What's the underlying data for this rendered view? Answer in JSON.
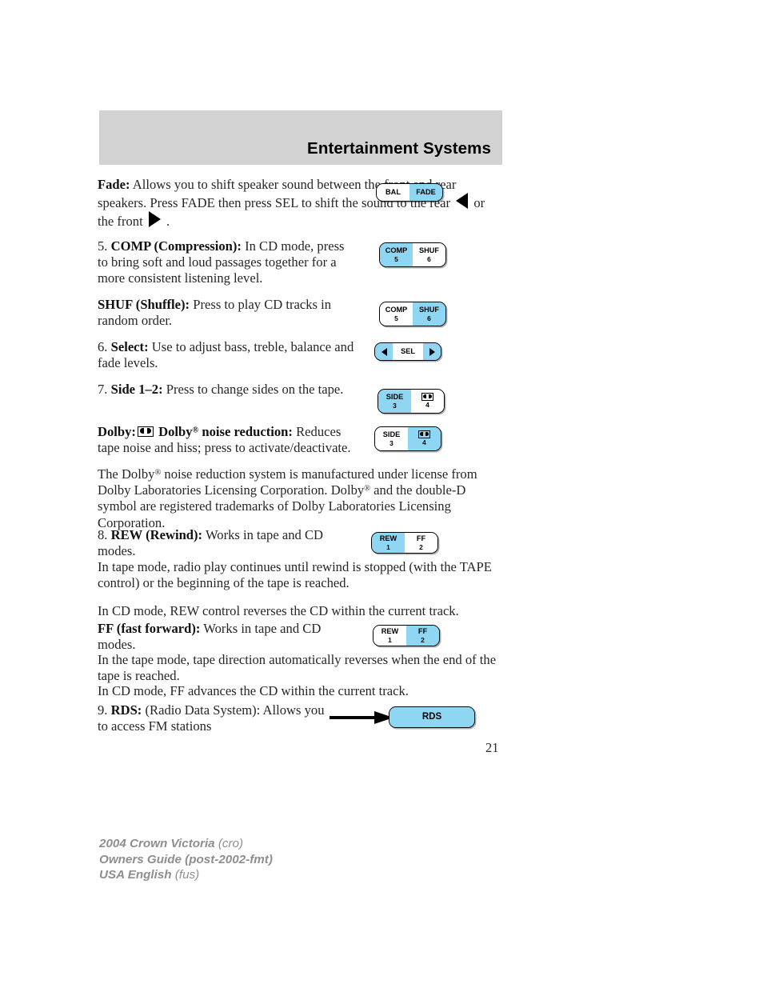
{
  "header": {
    "title": "Entertainment Systems"
  },
  "sections": {
    "fade": {
      "term": "Fade:",
      "text_before_rear_arrow": " Allows you to shift speaker sound between the front and rear speakers. Press FADE then press SEL to shift the sound to the rear ",
      "text_between_arrows": " or the front ",
      "text_after_front_arrow": " ."
    },
    "comp": {
      "number": "5.",
      "term": "COMP (Compression):",
      "text": " In CD mode, press to bring soft and loud passages together for a more consistent listening level."
    },
    "shuf": {
      "term": "SHUF (Shuffle):",
      "text": " Press to play CD tracks in random order."
    },
    "select": {
      "number": "6.",
      "term": "Select:",
      "text": " Use to adjust bass, treble, balance and fade levels."
    },
    "side": {
      "number": "7.",
      "term": "Side 1–2:",
      "text": " Press to change sides on the tape."
    },
    "dolby": {
      "term_a": "Dolby:",
      "term_b": "Dolby",
      "term_b_sup": "®",
      "term_c": "noise reduction:",
      "text": " Reduces tape noise and hiss; press to activate/deactivate.",
      "legal_part1": "The Dolby",
      "legal_sup1": "®",
      "legal_part2": " noise reduction system is manufactured under license from Dolby Laboratories Licensing Corporation. Dolby",
      "legal_sup2": "®",
      "legal_part3": " and the double-D symbol are registered trademarks of Dolby Laboratories Licensing Corporation."
    },
    "rew": {
      "number": "8.",
      "term": "REW (Rewind):",
      "text": " Works in tape and CD modes.",
      "para2": "In tape mode, radio play continues until rewind is stopped (with the TAPE control) or the beginning of the tape is reached.",
      "para3": "In CD mode, REW control reverses the CD within the current track."
    },
    "ff": {
      "term": "FF (fast forward):",
      "text": " Works in tape and CD modes.",
      "para2": "In the tape mode, tape direction automatically reverses when the end of the tape is reached.",
      "para3": "In CD mode, FF advances the CD within the current track."
    },
    "rds": {
      "number": "9.",
      "term": "RDS:",
      "text": " (Radio Data System): Allows you to access FM stations"
    }
  },
  "button_graphics": {
    "bal_fade": {
      "left_label": "BAL",
      "left_sub": "",
      "right_label": "FADE",
      "right_sub": "",
      "highlight": "right"
    },
    "comp_shuf_comp_on": {
      "left_label": "COMP",
      "left_sub": "5",
      "right_label": "SHUF",
      "right_sub": "6",
      "highlight": "left"
    },
    "comp_shuf_shuf_on": {
      "left_label": "COMP",
      "left_sub": "5",
      "right_label": "SHUF",
      "right_sub": "6",
      "highlight": "right"
    },
    "sel": {
      "label": "SEL",
      "left_icon": "triangle-left-icon",
      "right_icon": "triangle-right-icon",
      "highlight": "both-sides"
    },
    "side_side_on": {
      "left_label": "SIDE",
      "left_sub": "3",
      "right_label": "dolby-double-d-icon",
      "right_sub": "4",
      "highlight": "left"
    },
    "side_dolby_on": {
      "left_label": "SIDE",
      "left_sub": "3",
      "right_label": "dolby-double-d-icon",
      "right_sub": "4",
      "highlight": "right"
    },
    "rew_ff_rew_on": {
      "left_label": "REW",
      "left_sub": "1",
      "right_label": "FF",
      "right_sub": "2",
      "highlight": "left"
    },
    "rew_ff_ff_on": {
      "left_label": "REW",
      "left_sub": "1",
      "right_label": "FF",
      "right_sub": "2",
      "highlight": "right"
    },
    "rds": {
      "label": "RDS",
      "highlight": "all"
    }
  },
  "page_number": "21",
  "footer": {
    "line1_strong": "2004 Crown Victoria",
    "line1_light": " (cro)",
    "line2_strong": "Owners Guide (post-2002-fmt)",
    "line2_light": "",
    "line3_strong": "USA English",
    "line3_light": " (fus)"
  },
  "colors": {
    "header_band": "#d2d2d2",
    "button_highlight": "#8fd6f2",
    "footer_text": "#8e8e8e"
  }
}
